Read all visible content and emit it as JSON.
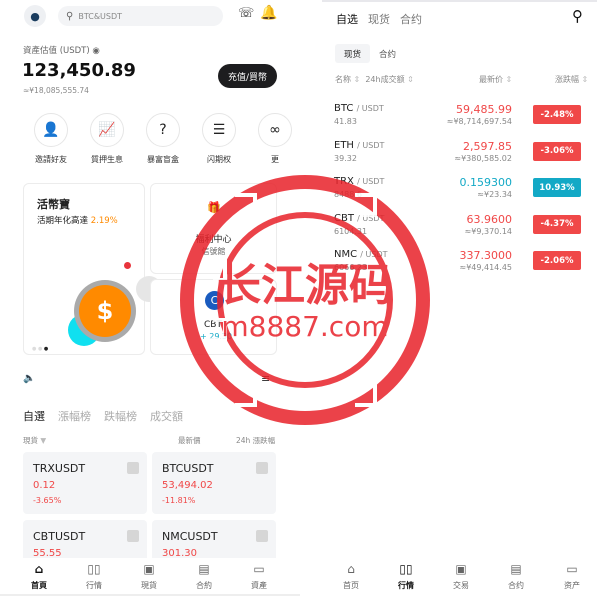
{
  "left": {
    "search_placeholder": "BTC&USDT",
    "asset_label": "資產估值 (USDT)",
    "asset_value": "123,450.89",
    "asset_cny": "≈¥18,085,555.74",
    "deposit_button": "充值/買幣",
    "quick": [
      {
        "label": "邀請好友",
        "icon": "add-user-icon"
      },
      {
        "label": "質押生息",
        "icon": "chart-icon"
      },
      {
        "label": "暴富盲盒",
        "icon": "mystery-box-icon"
      },
      {
        "label": "闪期权",
        "icon": "bookmark-icon"
      },
      {
        "label": "更",
        "icon": "more-icon"
      }
    ],
    "promo": {
      "title": "活幣寶",
      "subtitle": "活期年化高達",
      "rate": "2.19%"
    },
    "welfare": {
      "title": "福利中心",
      "subtitle": "信號館"
    },
    "cbt": {
      "name": "CBT",
      "change": "+ 29.30"
    },
    "tabs": [
      "自選",
      "漲幅榜",
      "跌幅榜",
      "成交額"
    ],
    "subheader": {
      "market": "現貨",
      "price": "最新價",
      "change": "24h 漲跌幅"
    },
    "grid": [
      {
        "symbol": "TRXUSDT",
        "price": "0.12",
        "change": "-3.65%"
      },
      {
        "symbol": "BTCUSDT",
        "price": "53,494.02",
        "change": "-11.81%"
      },
      {
        "symbol": "CBTUSDT",
        "price": "55.55",
        "change": ""
      },
      {
        "symbol": "NMCUSDT",
        "price": "301.30",
        "change": ""
      }
    ],
    "nav": [
      "首頁",
      "行情",
      "現貨",
      "合約",
      "資產"
    ]
  },
  "right": {
    "tabs": [
      "自选",
      "现货",
      "合约"
    ],
    "subtabs": [
      "现货",
      "合约"
    ],
    "headers": {
      "name": "名称",
      "volume": "24h成交额",
      "price": "最新价",
      "change": "涨跌幅"
    },
    "rows": [
      {
        "base": "BTC",
        "quote": "/ USDT",
        "volume": "41.83",
        "price": "59,485.99",
        "cny": "≈¥8,714,697.54",
        "change": "-2.48%",
        "up": false
      },
      {
        "base": "ETH",
        "quote": "/ USDT",
        "volume": "39.32",
        "price": "2,597.85",
        "cny": "≈¥380,585.02",
        "change": "-3.06%",
        "up": false
      },
      {
        "base": "TRX",
        "quote": "/ USDT",
        "volume": "8488.6",
        "price": "0.159300",
        "cny": "≈¥23.34",
        "change": "10.93%",
        "up": true
      },
      {
        "base": "CBT",
        "quote": "/ USDT",
        "volume": "6104.31",
        "price": "63.9600",
        "cny": "≈¥9,370.14",
        "change": "-4.37%",
        "up": false
      },
      {
        "base": "NMC",
        "quote": "/ USDT",
        "volume": "6066.23",
        "price": "337.3000",
        "cny": "≈¥49,414.45",
        "change": "-2.06%",
        "up": false
      }
    ],
    "nav": [
      "首页",
      "行情",
      "交易",
      "合约",
      "资产"
    ]
  },
  "watermark": {
    "title": "长江源码",
    "url": "m8887.com"
  },
  "colors": {
    "down": "#f04848",
    "up": "#13a9c6",
    "accent": "#ff8a00",
    "watermark": "#e8222a"
  }
}
